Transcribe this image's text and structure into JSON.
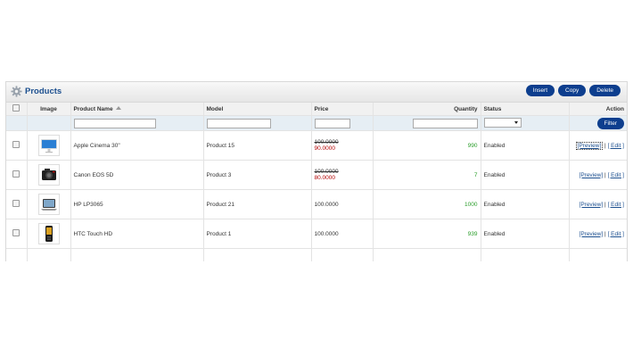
{
  "panel": {
    "title": "Products",
    "buttons": {
      "insert": "Insert",
      "copy": "Copy",
      "delete": "Delete"
    }
  },
  "columns": {
    "image": "Image",
    "name": "Product Name",
    "model": "Model",
    "price": "Price",
    "quantity": "Quantity",
    "status": "Status",
    "action": "Action"
  },
  "filter": {
    "button": "Filter",
    "name_value": "",
    "model_value": "",
    "price_value": "",
    "quantity_value": "",
    "status_value": ""
  },
  "products": [
    {
      "icon": "monitor-thumbnail",
      "name": "Apple Cinema 30\"",
      "model": "Product 15",
      "price": "100.0000",
      "special": "90.0000",
      "quantity": "990",
      "status": "Enabled"
    },
    {
      "icon": "camera-thumbnail",
      "name": "Canon EOS 5D",
      "model": "Product 3",
      "price": "100.0000",
      "special": "80.0000",
      "quantity": "7",
      "status": "Enabled"
    },
    {
      "icon": "laptop-thumbnail",
      "name": "HP LP3065",
      "model": "Product 21",
      "price": "100.0000",
      "special": "",
      "quantity": "1000",
      "status": "Enabled"
    },
    {
      "icon": "phone-thumbnail",
      "name": "HTC Touch HD",
      "model": "Product 1",
      "price": "100.0000",
      "special": "",
      "quantity": "939",
      "status": "Enabled"
    }
  ],
  "actions": {
    "preview": "[Preview]",
    "separator": " | ",
    "edit": "[ Edit ]"
  },
  "colors": {
    "accent": "#0d3e8e",
    "title": "#1c4f8f",
    "quantity": "#2a9d2a",
    "special": "#b30000"
  }
}
